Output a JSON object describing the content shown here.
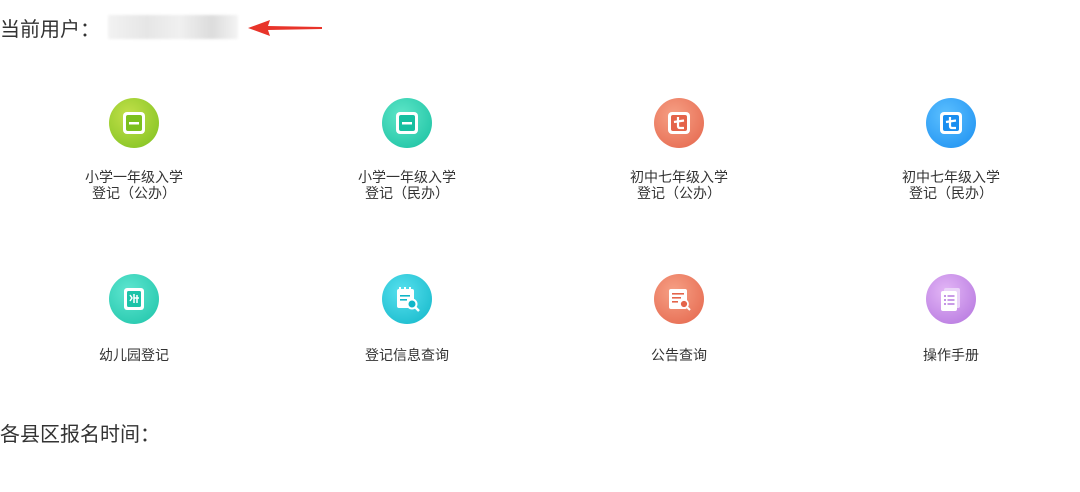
{
  "user": {
    "label": "当前用户："
  },
  "menu": [
    {
      "line1": "小学一年级入学",
      "line2": "登记（公办）",
      "icon": "grade-one-icon",
      "color_start": "#b6d93a",
      "color_end": "#7cc01e"
    },
    {
      "line1": "小学一年级入学",
      "line2": "登记（民办）",
      "icon": "grade-one-icon",
      "color_start": "#4fe0c0",
      "color_end": "#16bfa0"
    },
    {
      "line1": "初中七年级入学",
      "line2": "登记（公办）",
      "icon": "grade-seven-icon",
      "color_start": "#f4906f",
      "color_end": "#e4644a"
    },
    {
      "line1": "初中七年级入学",
      "line2": "登记（民办）",
      "icon": "grade-seven-icon",
      "color_start": "#4cb7ff",
      "color_end": "#1a8ef0"
    },
    {
      "line1": "幼儿园登记",
      "line2": "",
      "icon": "kindergarten-icon",
      "color_start": "#4fe0c8",
      "color_end": "#1cc3a8"
    },
    {
      "line1": "登记信息查询",
      "line2": "",
      "icon": "register-search-icon",
      "color_start": "#3fd7e6",
      "color_end": "#10b6c8"
    },
    {
      "line1": "公告查询",
      "line2": "",
      "icon": "notice-search-icon",
      "color_start": "#f4906f",
      "color_end": "#e4644a"
    },
    {
      "line1": "操作手册",
      "line2": "",
      "icon": "manual-icon",
      "color_start": "#d9a6f2",
      "color_end": "#b272dd"
    }
  ],
  "section": {
    "title": "各县区报名时间："
  },
  "colors": {
    "arrow": "#e8342a",
    "text": "#333333"
  }
}
